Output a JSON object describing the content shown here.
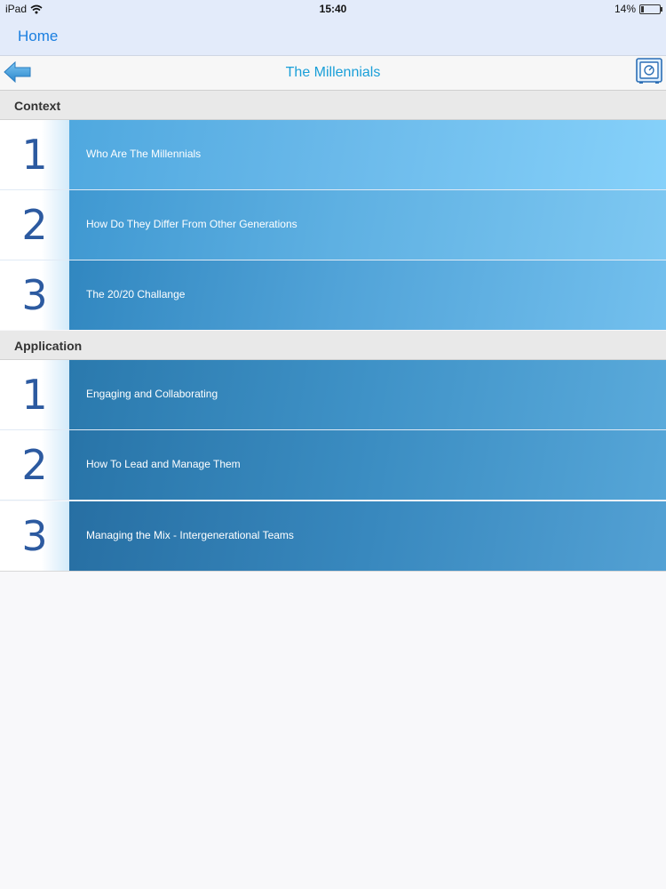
{
  "status_bar": {
    "device": "iPad",
    "time": "15:40",
    "battery": "14%",
    "wifi_icon": "wifi-icon",
    "battery_icon": "battery-icon"
  },
  "nav": {
    "home_label": "Home"
  },
  "title_bar": {
    "title": "The Millennials",
    "back_icon": "back-arrow-icon",
    "safe_icon": "safe-icon"
  },
  "sections": [
    {
      "header": "Context",
      "rows": [
        {
          "number": "1",
          "label": "Who Are The Millennials"
        },
        {
          "number": "2",
          "label": "How Do They Differ From Other Generations"
        },
        {
          "number": "3",
          "label": "The 20/20 Challange"
        }
      ]
    },
    {
      "header": "Application",
      "rows": [
        {
          "number": "1",
          "label": "Engaging and Collaborating"
        },
        {
          "number": "2",
          "label": "How To Lead and Manage Them"
        },
        {
          "number": "3",
          "label": "Managing the Mix - Intergenerational Teams"
        }
      ]
    }
  ],
  "colors": {
    "accent": "#1b7fe0",
    "title": "#1a9fd8",
    "number": "#2c5aa0",
    "row_light": "#7ccaf5",
    "row_dark": "#2b7bac"
  }
}
